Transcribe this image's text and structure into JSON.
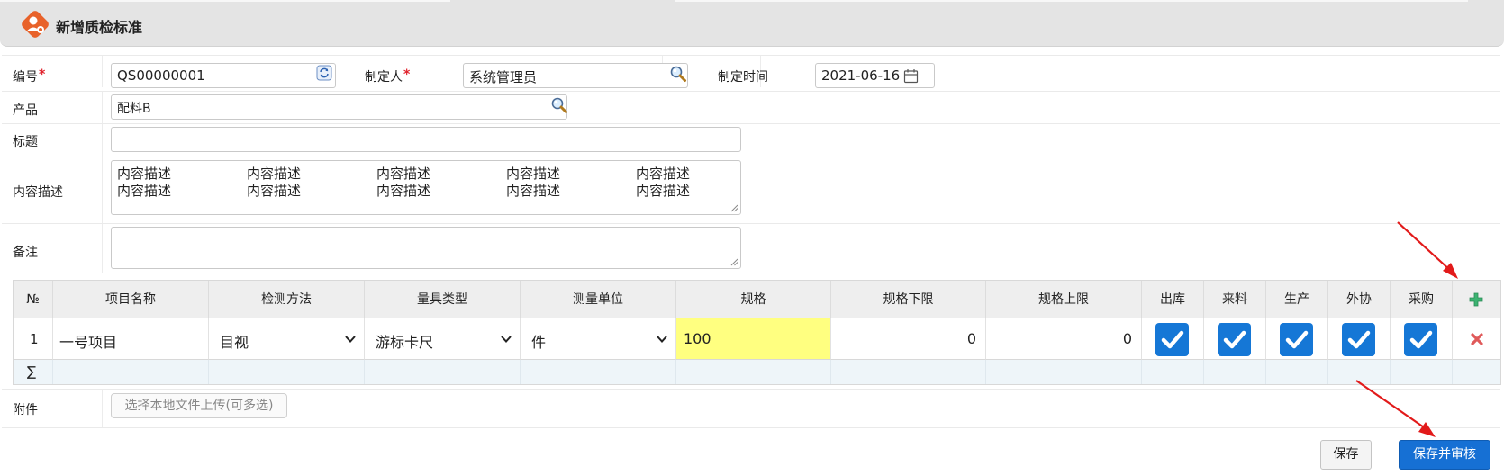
{
  "header": {
    "title": "新增质检标准"
  },
  "form": {
    "code": {
      "label": "编号",
      "value": "QS00000001"
    },
    "maker": {
      "label": "制定人",
      "value": "系统管理员"
    },
    "date": {
      "label": "制定时间",
      "value": "2021-06-16"
    },
    "product": {
      "label": "产品",
      "value": "配料B"
    },
    "title": {
      "label": "标题",
      "value": ""
    },
    "content": {
      "label": "内容描述",
      "line1": [
        "内容描述",
        "内容描述",
        "内容描述",
        "内容描述",
        "内容描述"
      ],
      "line2": [
        "内容描述",
        "内容描述",
        "内容描述",
        "内容描述",
        "内容描述"
      ]
    },
    "remark": {
      "label": "备注",
      "value": ""
    },
    "attachment": {
      "label": "附件",
      "button": "选择本地文件上传(可多选)"
    }
  },
  "grid": {
    "columns": [
      "№",
      "项目名称",
      "检测方法",
      "量具类型",
      "测量单位",
      "规格",
      "规格下限",
      "规格上限",
      "出库",
      "来料",
      "生产",
      "外协",
      "采购"
    ],
    "row": {
      "no": "1",
      "name": "一号项目",
      "method": "目视",
      "tool": "游标卡尺",
      "unit": "件",
      "spec": "100",
      "lower": "0",
      "upper": "0",
      "checks": {
        "outbound": true,
        "incoming": true,
        "production": true,
        "outsourcing": true,
        "purchase": true
      }
    },
    "sum_symbol": "∑"
  },
  "buttons": {
    "save": "保存",
    "save_audit": "保存并审核"
  },
  "colors": {
    "accent": "#1670d4",
    "checkbox": "#1577d6",
    "spec_highlight": "#ffff80",
    "required": "#e0202a",
    "logo": "#e8622a"
  }
}
